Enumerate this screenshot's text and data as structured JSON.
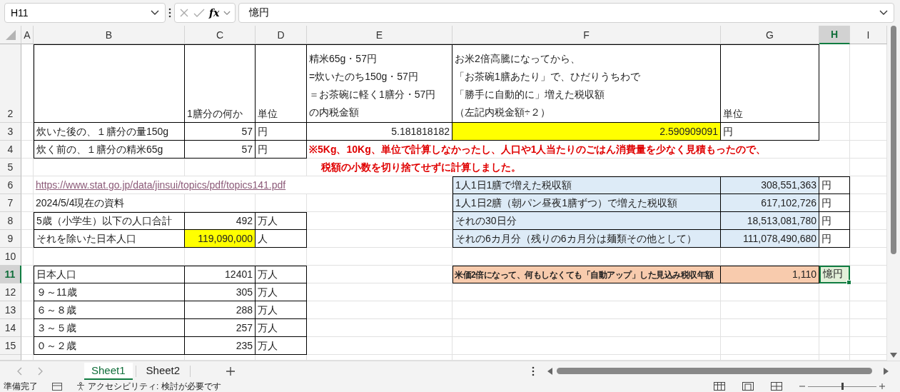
{
  "formula_bar": {
    "name_box": "H11",
    "fx_label": "fx",
    "formula": "憶円"
  },
  "columns": [
    {
      "label": "A",
      "selected": false
    },
    {
      "label": "B",
      "selected": false
    },
    {
      "label": "C",
      "selected": false
    },
    {
      "label": "D",
      "selected": false
    },
    {
      "label": "E",
      "selected": false
    },
    {
      "label": "F",
      "selected": false
    },
    {
      "label": "G",
      "selected": false
    },
    {
      "label": "H",
      "selected": true
    },
    {
      "label": "I",
      "selected": false
    }
  ],
  "rows": [
    {
      "number": "2",
      "selected": false,
      "cells": [
        {
          "boxed": true
        },
        {
          "kind": "text",
          "boxed": true,
          "text": "1膳分の何か"
        },
        {
          "kind": "text",
          "boxed": true,
          "text": "単位"
        },
        {
          "kind": "text",
          "boxed": true,
          "lines": [
            "精米65g・57円",
            "=炊いたのち150g・57円",
            "＝お茶碗に軽く1膳分・57円",
            "の内税金額"
          ]
        },
        {
          "kind": "text",
          "boxed": true,
          "lines": [
            "お米2倍高騰になってから、",
            "「お茶碗1膳あたり」で、ひだりうちわで",
            "「勝手に自動的に」増えた税収額",
            "（左記内税金額÷２）"
          ]
        },
        {
          "kind": "text",
          "boxed": true,
          "text": "単位"
        },
        {
          "boxed": false
        }
      ]
    },
    {
      "number": "3",
      "selected": false,
      "cells": [
        {
          "kind": "text",
          "boxed": true,
          "text": "炊いた後の、１膳分の量150g"
        },
        {
          "kind": "number",
          "boxed": true,
          "text": "57"
        },
        {
          "kind": "text",
          "boxed": true,
          "text": "円"
        },
        {
          "kind": "number",
          "boxed": true,
          "text": "5.181818182"
        },
        {
          "kind": "number",
          "boxed": true,
          "color": "#ffff00",
          "text": "2.590909091"
        },
        {
          "kind": "text",
          "boxed": true,
          "text": "円"
        },
        {
          "boxed": false
        }
      ]
    },
    {
      "number": "4",
      "selected": false,
      "cells": [
        {
          "kind": "text",
          "boxed": true,
          "text": "炊く前の、１膳分の精米65g"
        },
        {
          "kind": "number",
          "boxed": true,
          "text": "57"
        },
        {
          "kind": "text",
          "boxed": true,
          "text": "円"
        },
        {
          "kind": "note",
          "boxed": false,
          "text": "※5Kg、10Kg、単位で計算しなかったし、人口や1人当たりのごはん消費量を少なく見積もったので、"
        },
        {
          "boxed": false
        },
        {
          "boxed": false
        },
        {
          "boxed": false
        }
      ]
    },
    {
      "number": "5",
      "selected": false,
      "cells": [
        {
          "boxed": false
        },
        {
          "boxed": false
        },
        {
          "boxed": false
        },
        {
          "kind": "note-indented",
          "boxed": false,
          "text": "税額の小数を切り捨てせずに計算しました。"
        },
        {
          "boxed": false
        },
        {
          "boxed": false
        },
        {
          "boxed": false
        }
      ]
    },
    {
      "number": "6",
      "selected": false,
      "cells": [
        {
          "kind": "link",
          "boxed": false,
          "text": "https://www.stat.go.jp/data/jinsui/topics/pdf/topics141.pdf"
        },
        {
          "boxed": false
        },
        {
          "boxed": false
        },
        {
          "boxed": false
        },
        {
          "kind": "text",
          "boxed": true,
          "color": "#ddebf7",
          "text": "1人1日1膳で増えた税収額"
        },
        {
          "kind": "number",
          "boxed": true,
          "color": "#ddebf7",
          "text": "308,551,363"
        },
        {
          "kind": "text",
          "boxed": true,
          "text": "円"
        }
      ]
    },
    {
      "number": "7",
      "selected": false,
      "cells": [
        {
          "kind": "text",
          "boxed": false,
          "text": "2024/5/4現在の資料"
        },
        {
          "boxed": false
        },
        {
          "boxed": false
        },
        {
          "boxed": false
        },
        {
          "kind": "text",
          "boxed": true,
          "color": "#ddebf7",
          "text": "1人1日2膳（朝パン昼夜1膳ずつ）で増えた税収額"
        },
        {
          "kind": "number",
          "boxed": true,
          "color": "#ddebf7",
          "text": "617,102,726"
        },
        {
          "kind": "text",
          "boxed": true,
          "text": "円"
        }
      ]
    },
    {
      "number": "8",
      "selected": false,
      "cells": [
        {
          "kind": "text",
          "boxed": true,
          "text": "5歳（小学生）以下の人口合計"
        },
        {
          "kind": "number",
          "boxed": true,
          "text": "492"
        },
        {
          "kind": "text",
          "boxed": true,
          "text": "万人"
        },
        {
          "boxed": false
        },
        {
          "kind": "text",
          "boxed": true,
          "color": "#ddebf7",
          "text": "それの30日分"
        },
        {
          "kind": "number",
          "boxed": true,
          "color": "#ddebf7",
          "text": "18,513,081,780"
        },
        {
          "kind": "text",
          "boxed": true,
          "text": "円"
        }
      ]
    },
    {
      "number": "9",
      "selected": false,
      "cells": [
        {
          "kind": "text",
          "boxed": true,
          "text": "それを除いた日本人口"
        },
        {
          "kind": "number",
          "boxed": true,
          "color": "#ffff00",
          "text": "119,090,000"
        },
        {
          "kind": "text",
          "boxed": true,
          "text": "人"
        },
        {
          "boxed": false
        },
        {
          "kind": "text",
          "boxed": true,
          "color": "#ddebf7",
          "text": "それの6カ月分（残りの6カ月分は麺類その他として）"
        },
        {
          "kind": "number",
          "boxed": true,
          "color": "#ddebf7",
          "text": "111,078,490,680"
        },
        {
          "kind": "text",
          "boxed": true,
          "text": "円"
        }
      ]
    },
    {
      "number": "10",
      "selected": false,
      "cells": [
        {
          "boxed": false
        },
        {
          "boxed": false
        },
        {
          "boxed": false
        },
        {
          "boxed": false
        },
        {
          "boxed": false
        },
        {
          "boxed": false
        },
        {
          "boxed": false
        }
      ]
    },
    {
      "number": "11",
      "selected": true,
      "cells": [
        {
          "kind": "text",
          "boxed": true,
          "text": "日本人口"
        },
        {
          "kind": "number",
          "boxed": true,
          "text": "12401"
        },
        {
          "kind": "text",
          "boxed": true,
          "text": "万人"
        },
        {
          "boxed": false
        },
        {
          "kind": "small-bold",
          "boxed": true,
          "color": "#f8cbad",
          "text": "米価2倍になって、何もしなくても「自動アップ」した見込み税収年額"
        },
        {
          "kind": "number",
          "boxed": true,
          "color": "#f8cbad",
          "text": "1,110"
        },
        {
          "kind": "text",
          "boxed": true,
          "selected": true,
          "text": "憶円"
        }
      ]
    },
    {
      "number": "12",
      "selected": false,
      "cells": [
        {
          "kind": "text",
          "boxed": true,
          "text": "９～11歳"
        },
        {
          "kind": "number",
          "boxed": true,
          "text": "305"
        },
        {
          "kind": "text",
          "boxed": true,
          "text": "万人"
        },
        {
          "boxed": false
        },
        {
          "boxed": false
        },
        {
          "boxed": false
        },
        {
          "boxed": false
        }
      ]
    },
    {
      "number": "13",
      "selected": false,
      "cells": [
        {
          "kind": "text",
          "boxed": true,
          "text": "６～８歳"
        },
        {
          "kind": "number",
          "boxed": true,
          "text": "288"
        },
        {
          "kind": "text",
          "boxed": true,
          "text": "万人"
        },
        {
          "boxed": false
        },
        {
          "boxed": false
        },
        {
          "boxed": false
        },
        {
          "boxed": false
        }
      ]
    },
    {
      "number": "14",
      "selected": false,
      "cells": [
        {
          "kind": "text",
          "boxed": true,
          "text": "３～５歳"
        },
        {
          "kind": "number",
          "boxed": true,
          "text": "257"
        },
        {
          "kind": "text",
          "boxed": true,
          "text": "万人"
        },
        {
          "boxed": false
        },
        {
          "boxed": false
        },
        {
          "boxed": false
        },
        {
          "boxed": false
        }
      ]
    },
    {
      "number": "15",
      "selected": false,
      "cells": [
        {
          "kind": "text",
          "boxed": true,
          "text": "０～２歳"
        },
        {
          "kind": "number",
          "boxed": true,
          "text": "235"
        },
        {
          "kind": "text",
          "boxed": true,
          "text": "万人"
        },
        {
          "boxed": false
        },
        {
          "boxed": false
        },
        {
          "boxed": false
        },
        {
          "boxed": false
        }
      ]
    }
  ],
  "sheet_tabs": [
    {
      "label": "Sheet1",
      "selected": true
    },
    {
      "label": "Sheet2",
      "selected": false
    }
  ],
  "status_bar": {
    "ready": "準備完了",
    "accessibility": "アクセシビリティ: 検討が必要です",
    "zoom": {
      "level": 0.5
    }
  }
}
